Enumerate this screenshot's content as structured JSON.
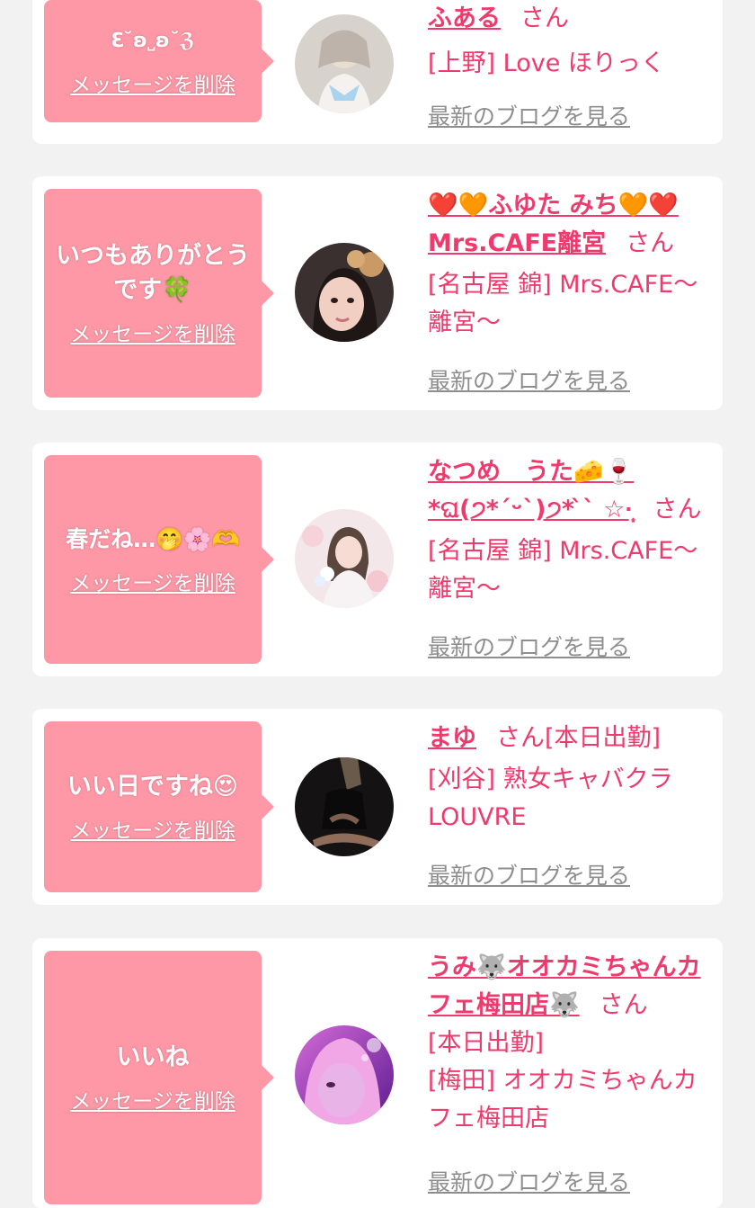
{
  "messages": [
    {
      "bubble_text": "ℇ˘ʚ˽ʚ˘ℨ",
      "delete_label": "メッセージを削除",
      "name": "ふある",
      "honorific": "さん",
      "shift": "",
      "shop": "[上野] Love ほりっく",
      "blog_label": "最新のブログを見る"
    },
    {
      "bubble_text": "いつもありがとうです🍀",
      "delete_label": "メッセージを削除",
      "name": "❤️🧡ふゆた みち🧡❤️ Mrs.CAFE離宮",
      "honorific": "さん",
      "shift": "",
      "shop": "[名古屋 錦] Mrs.CAFE〜離宮〜",
      "blog_label": "最新のブログを見る"
    },
    {
      "bubble_text": "春だね…🤭🌸🫶",
      "delete_label": "メッセージを削除",
      "name": "なつめ　うた🧀🍷 *ଘ(੭*ˊᵕˋ)੭* ̀ˋ ☆·̩͙",
      "honorific": "さん",
      "shift": "",
      "shop": "[名古屋 錦] Mrs.CAFE〜離宮〜",
      "blog_label": "最新のブログを見る"
    },
    {
      "bubble_text": "いい日ですね😍",
      "delete_label": "メッセージを削除",
      "name": "まゆ",
      "honorific": "さん",
      "shift": "[本日出勤]",
      "shop": "[刈谷] 熟女キャバクラLOUVRE",
      "blog_label": "最新のブログを見る"
    },
    {
      "bubble_text": "いいね",
      "delete_label": "メッセージを削除",
      "name": "うみ🐺オオカミちゃんカフェ梅田店🐺",
      "honorific": "さん",
      "shift": "[本日出勤]",
      "shop": "[梅田] オオカミちゃんカフェ梅田店",
      "blog_label": "最新のブログを見る"
    }
  ],
  "colors": {
    "page_bg": "#f2f2f2",
    "card_bg": "#ffffff",
    "bubble_bg": "#fe97a6",
    "accent_pink": "#ee3a6c",
    "link_gray": "#8e8e8e"
  }
}
